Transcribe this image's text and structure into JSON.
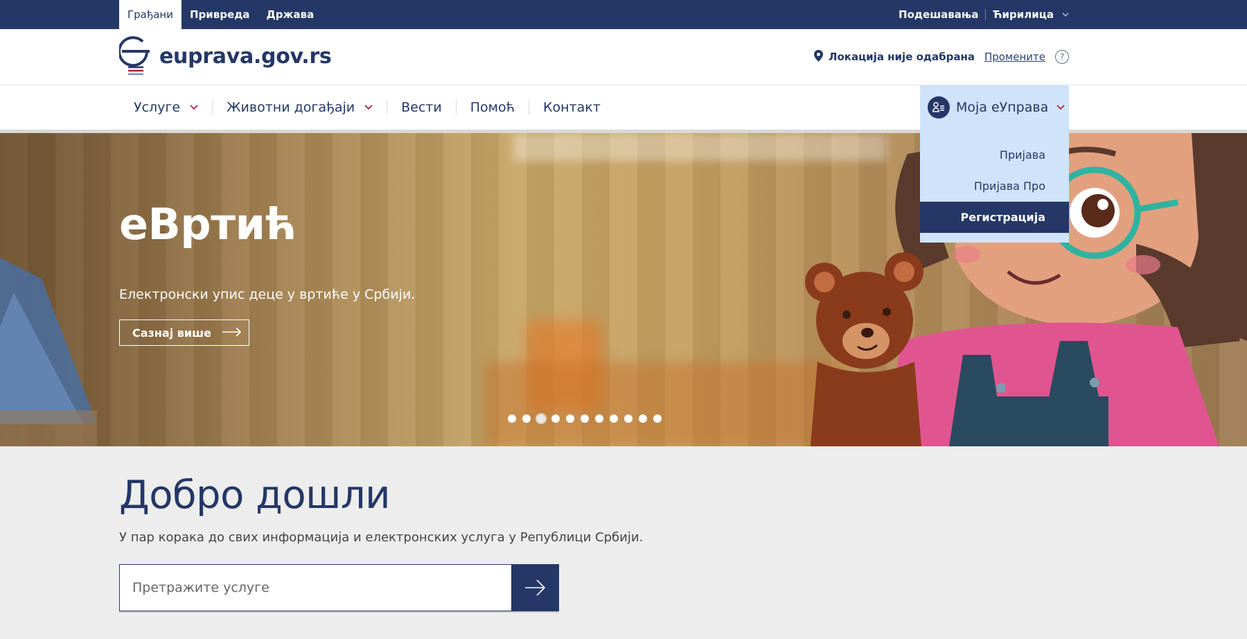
{
  "topbar": {
    "tabs": [
      "Грађани",
      "Привреда",
      "Држава"
    ],
    "settings": "Подешавања",
    "script": "Ћирилица"
  },
  "header": {
    "site_name": "euprava.gov.rs",
    "location_text": "Локација није одабрана",
    "change_link": "Промените",
    "help": "?"
  },
  "nav": {
    "items": [
      "Услуге",
      "Животни догађаји",
      "Вести",
      "Помоћ",
      "Контакт"
    ]
  },
  "account": {
    "label": "Моја еУправа",
    "menu": [
      "Пријава",
      "Пријава Про",
      "Регистрација"
    ]
  },
  "hero": {
    "title": "еВртић",
    "subtitle": "Електронски упис деце у вртиће у Србији.",
    "cta": "Сазнај више",
    "slide_count": 11,
    "active_slide": 3
  },
  "welcome": {
    "title": "Добро дошли",
    "lead": "У пар корака до свих информација и електронских услуга у Републици Србији.",
    "search_placeholder": "Претражите услуге"
  },
  "colors": {
    "primary": "#243766",
    "accent": "#b2203a",
    "dropdown_bg": "#cfe4fb",
    "page_bg": "#ededed"
  },
  "icons": {
    "location": "location-pin-icon",
    "help": "question-icon",
    "account": "user-icon",
    "arrow": "arrow-right-icon",
    "chevron": "chevron-down-icon"
  }
}
